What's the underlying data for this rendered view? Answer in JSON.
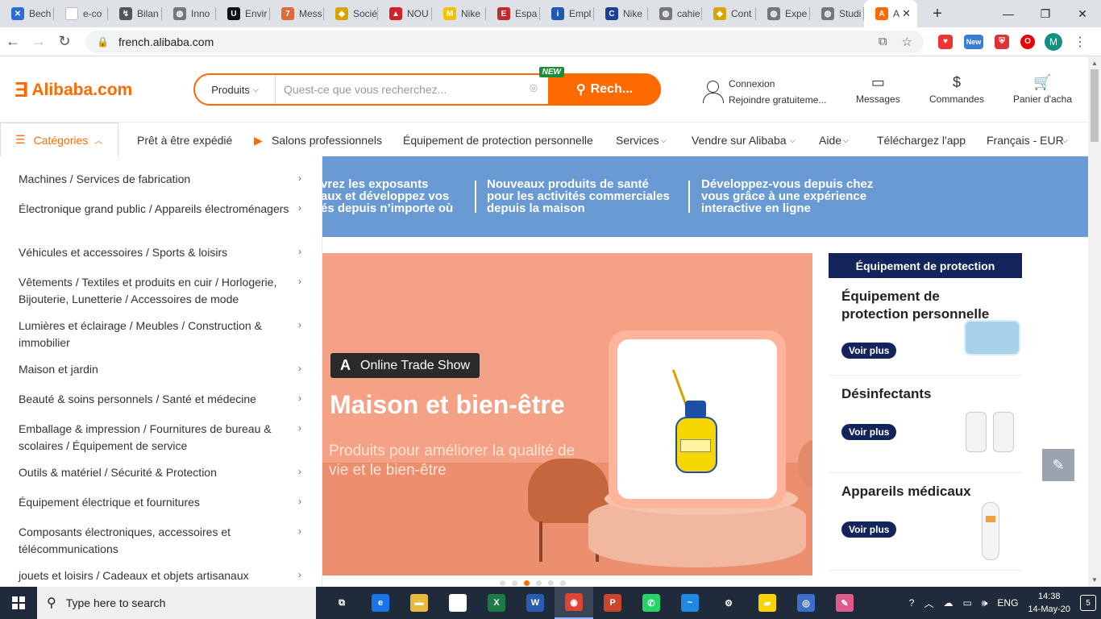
{
  "browser": {
    "tabs": [
      {
        "label": "Bech",
        "color": "#2d6bd8",
        "glyph": "✕"
      },
      {
        "label": "e-co",
        "color": "#ffffff",
        "glyph": ""
      },
      {
        "label": "Bilan",
        "color": "#555555",
        "glyph": "↯"
      },
      {
        "label": "Inno",
        "color": "#777777",
        "glyph": "◍"
      },
      {
        "label": "Envir",
        "color": "#111111",
        "glyph": "U"
      },
      {
        "label": "Mess",
        "color": "#e06a3b",
        "glyph": "7"
      },
      {
        "label": "Socié",
        "color": "#d9a400",
        "glyph": "◆"
      },
      {
        "label": "NOU",
        "color": "#d3202a",
        "glyph": "▲"
      },
      {
        "label": "Nike",
        "color": "#f2c200",
        "glyph": "M"
      },
      {
        "label": "Espa",
        "color": "#c32a2a",
        "glyph": "E"
      },
      {
        "label": "Empl",
        "color": "#1c5ab5",
        "glyph": "i"
      },
      {
        "label": "Nike",
        "color": "#1c3f9b",
        "glyph": "C"
      },
      {
        "label": "cahie",
        "color": "#777777",
        "glyph": "◍"
      },
      {
        "label": "Cont",
        "color": "#d9a400",
        "glyph": "◆"
      },
      {
        "label": "Expe",
        "color": "#777777",
        "glyph": "◍"
      },
      {
        "label": "Studi",
        "color": "#777777",
        "glyph": "◍"
      }
    ],
    "active_tab": {
      "label": "A",
      "color": "#ff6a00",
      "glyph": "A",
      "close": "✕"
    },
    "new_tab": "+",
    "window_controls": [
      "—",
      "❐",
      "✕"
    ],
    "url": "french.alibaba.com",
    "ext_new_label": "New",
    "profile_initial": "M"
  },
  "header": {
    "logo_mark": "Ǝ",
    "logo_text": "Alibaba.com",
    "search_category": "Produits",
    "search_placeholder": "Quest-ce que vous recherchez...",
    "search_button": "Rech...",
    "new_badge": "NEW",
    "login": "Connexion",
    "join": "Rejoindre gratuiteme...",
    "messages": "Messages",
    "orders": "Commandes",
    "cart": "Panier d'acha"
  },
  "menubar": {
    "categories": "Catégories",
    "items": [
      "Prêt à être expédié",
      "Salons professionnels",
      "Équipement de protection personnelle",
      "Services",
      "Vendre sur Alibaba",
      "Aide",
      "Téléchargez l'app",
      "Français - EUR"
    ]
  },
  "strip": {
    "col1": [
      "vrez les exposants",
      "aux et développez vos",
      "és depuis n’importe où"
    ],
    "col2": [
      "Nouveaux produits de santé",
      "pour les activités commerciales",
      "depuis la maison"
    ],
    "col3": [
      "Développez-vous depuis chez",
      "vous grâce à une expérience",
      "interactive en ligne"
    ]
  },
  "categories_menu": [
    "Machines / Services de fabrication",
    "Électronique grand public / Appareils électroménagers",
    "Véhicules et accessoires / Sports & loisirs",
    "Vêtements / Textiles et produits en cuir / Horlogerie, Bijouterie, Lunetterie / Accessoires de mode",
    "Lumières et éclairage / Meubles / Construction & immobilier",
    "Maison et jardin",
    "Beauté & soins personnels / Santé et médecine",
    "Emballage & impression / Fournitures de bureau & scolaires / Équipement de service",
    "Outils & matériel / Sécurité & Protection",
    "Équipement électrique et fournitures",
    "Composants électroniques, accessoires et télécommunications",
    "jouets et loisirs / Cadeaux et objets artisanaux"
  ],
  "banner": {
    "chip_mark": "A",
    "chip": "Online Trade Show",
    "title": "Maison et bien-être",
    "subtitle": "Produits pour améliorer la qualité de vie et le bien-être"
  },
  "side_panel": {
    "header": "Équipement de protection",
    "items": [
      {
        "title": "Équipement de protection personnelle",
        "button": "Voir plus"
      },
      {
        "title": "Désinfectants",
        "button": "Voir plus"
      },
      {
        "title": "Appareils médicaux",
        "button": "Voir plus"
      }
    ]
  },
  "taskbar": {
    "search": "Type here to search",
    "apps": [
      {
        "name": "task-view",
        "glyph": "⧉",
        "color": "transparent"
      },
      {
        "name": "edge",
        "glyph": "e",
        "color": "#1a73e8"
      },
      {
        "name": "file-explorer",
        "glyph": "▬",
        "color": "#e8b93a"
      },
      {
        "name": "store",
        "glyph": "▦",
        "color": "#ffffff"
      },
      {
        "name": "excel",
        "glyph": "X",
        "color": "#1d7a44"
      },
      {
        "name": "word",
        "glyph": "W",
        "color": "#2a5bb0"
      },
      {
        "name": "chrome",
        "glyph": "◉",
        "color": "#db4437"
      },
      {
        "name": "powerpoint",
        "glyph": "P",
        "color": "#c9462c"
      },
      {
        "name": "whatsapp",
        "glyph": "✆",
        "color": "#25d366"
      },
      {
        "name": "messenger",
        "glyph": "~",
        "color": "#1e88e5"
      },
      {
        "name": "settings",
        "glyph": "⚙",
        "color": "transparent"
      },
      {
        "name": "sticky-notes",
        "glyph": "▰",
        "color": "#f7d300"
      },
      {
        "name": "app-blue",
        "glyph": "◎",
        "color": "#3d6fc9"
      },
      {
        "name": "app-paint",
        "glyph": "✎",
        "color": "#e05b8a"
      }
    ],
    "lang": "ENG",
    "time": "14:38",
    "date": "14-May-20",
    "notifications": "5"
  }
}
